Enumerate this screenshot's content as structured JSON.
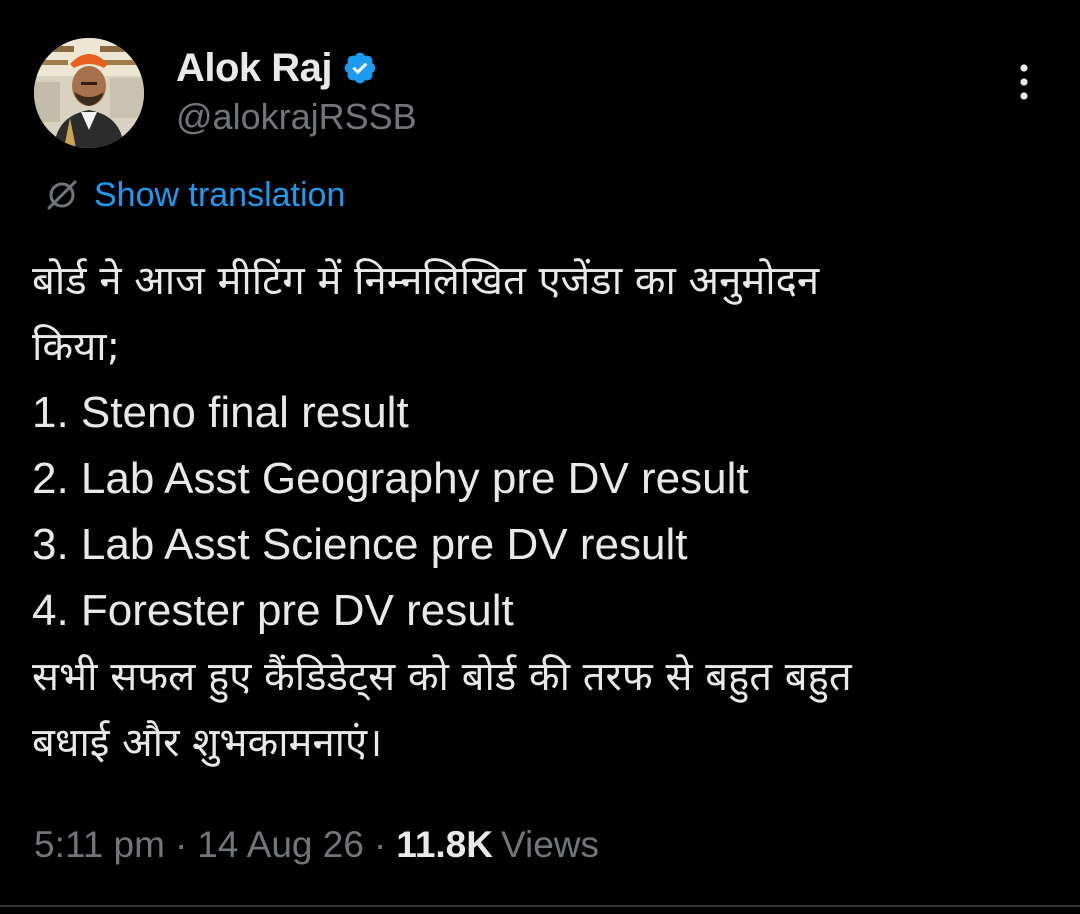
{
  "author": {
    "display_name": "Alok Raj",
    "handle": "@alokrajRSSB",
    "verified": true,
    "avatar_icon": "profile-photo-avatar"
  },
  "actions": {
    "more_icon": "more-vertical-icon"
  },
  "translation": {
    "icon": "globe-translate-icon",
    "label": "Show translation"
  },
  "body": {
    "lines": [
      "बोर्ड ने आज मीटिंग में निम्नलिखित एजेंडा का अनुमोदन",
      "किया;",
      "1. Steno final result",
      "2. Lab Asst Geography pre DV result",
      "3. Lab Asst Science pre DV result",
      "4. Forester pre DV result",
      "सभी सफल हुए कैंडिडेट्स को बोर्ड की तरफ से बहुत बहुत",
      "बधाई और शुभकामनाएं।"
    ]
  },
  "meta": {
    "time": "5:11 pm",
    "separator": "·",
    "date": "14 Aug 26",
    "views_count": "11.8K",
    "views_label": "Views"
  },
  "colors": {
    "background": "#000000",
    "text_primary": "#e7e9ea",
    "text_secondary": "#71767b",
    "accent": "#1d9bf0",
    "divider": "#2f3336"
  }
}
